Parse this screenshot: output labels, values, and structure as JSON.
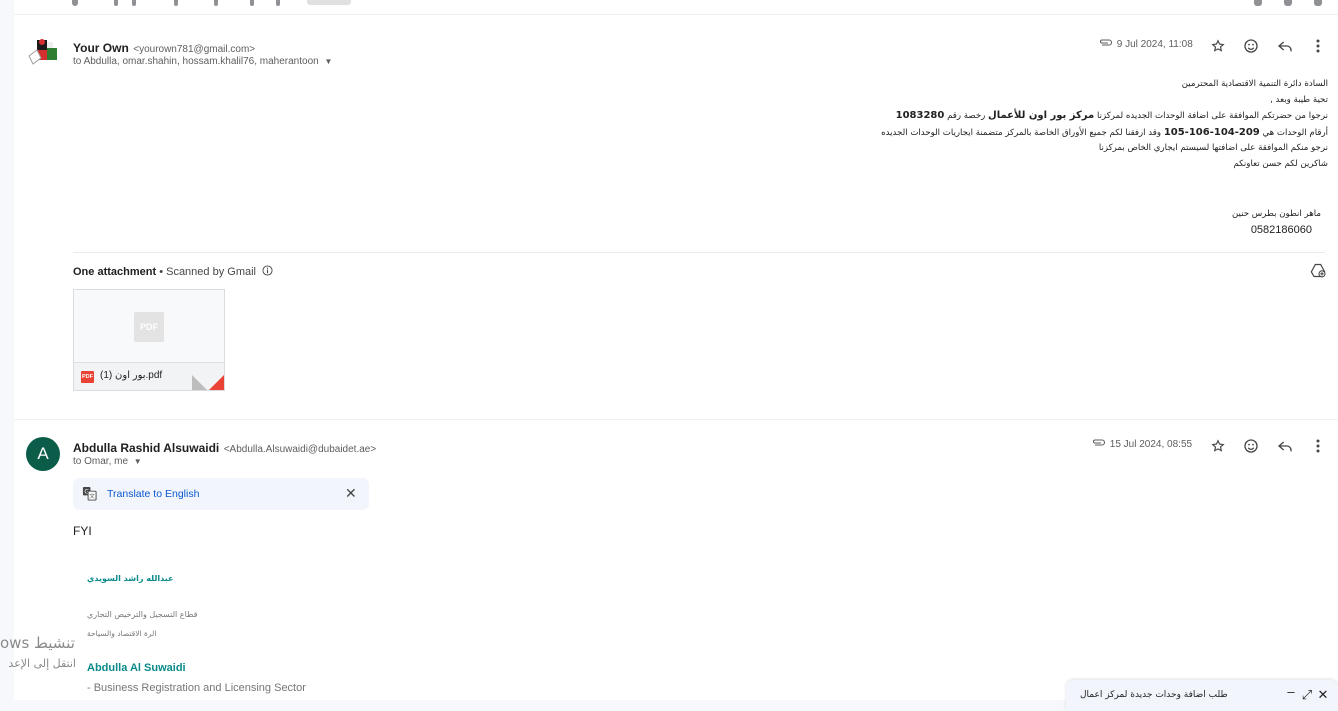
{
  "message1": {
    "sender_name": "Your Own",
    "sender_email": "<yourown781@gmail.com>",
    "recipients": "to Abdulla, omar.shahin, hossam.khalil76, maherantoon",
    "date": "9 Jul 2024, 11:08",
    "body": {
      "line1": "السادة دائرة التنمية الاقتصادية المحترمين",
      "line2": "تحية طيبة وبعد ,",
      "line3_a": "نرجوا من حضرتكم الموافقة على اضافة الوحدات الجديده لمركزنا ",
      "line3_bold_name": "مركز بور اون للأعمال",
      "line3_b": " رخصة رقم ",
      "line3_bold_num": "1083280",
      "line4_a": "أرقام الوحدات هي ",
      "line4_bold": "105-106-104-209",
      "line4_b": " وقد ارفقنا لكم جميع الأوراق الخاصة بالمركز متضمنة ايجاريات الوحدات الجديده",
      "line5": "نرجو منكم الموافقة على اضافتها لسيستم ايجاري الخاص بمركزنا",
      "line6": "شاكرين لكم حسن تعاونكم",
      "signature_name": "ماهر انطون بطرس حنين",
      "signature_phone": "0582186060"
    },
    "attachments_header": "One attachment",
    "scanned_label": " • Scanned by Gmail",
    "attachment": {
      "filename": "بور اون (1).pdf",
      "type_label": "PDF"
    }
  },
  "message2": {
    "avatar_letter": "A",
    "sender_name": "Abdulla Rashid Alsuwaidi",
    "sender_email": "<Abdulla.Alsuwaidi@dubaidet.ae>",
    "recipients": "to Omar, me",
    "date": "15 Jul 2024, 08:55",
    "translate_label": "Translate to English",
    "body": "FYI",
    "sig_ar_name": "عبدالله راشد السويدي",
    "sig_ar_sector": "قطاع التسجيل والترخيص التجاري",
    "sig_ar_dept": "الرة الاقتصاد والسياحة",
    "sig_en_name": "Abdulla Al Suwaidi",
    "sig_en_sector": "- Business Registration and Licensing Sector"
  },
  "watermark": {
    "line1": "تنشيط",
    "line1_tail": "ows",
    "line2": "انتقل إلى الإعد"
  },
  "compose": {
    "title": "طلب اضافة وحدات جديدة لمركز اعمال"
  },
  "colors": {
    "accent_link": "#0b57d0",
    "avatar_bg": "#0b5d4a",
    "signature_teal": "#0a8a8a",
    "pdf_red": "#ea4335"
  }
}
